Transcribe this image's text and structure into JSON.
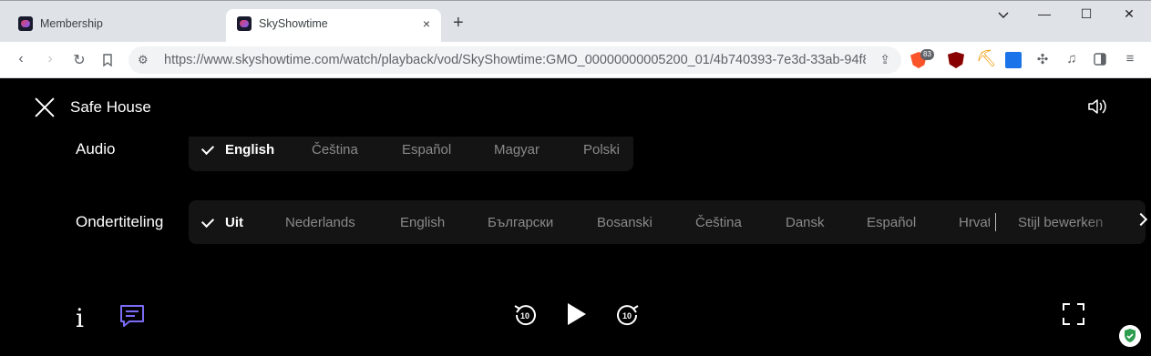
{
  "browser": {
    "tabs": [
      {
        "label": "Membership",
        "active": false
      },
      {
        "label": "SkyShowtime",
        "active": true
      }
    ],
    "tab_close": "×",
    "new_tab": "+",
    "window_controls": {
      "minimize_icon": "chevron-down-icon",
      "min": "—",
      "max": "☐",
      "close": "✕"
    },
    "url": "https://www.skyshowtime.com/watch/playback/vod/SkyShowtime:GMO_00000000005200_01/4b740393-7e3d-33ab-94f8-a...",
    "extension_badge": "83"
  },
  "player": {
    "title": "Safe House",
    "audio": {
      "label": "Audio",
      "options": [
        "English",
        "Čeština",
        "Español",
        "Magyar",
        "Polski"
      ],
      "selected": "English"
    },
    "subtitles": {
      "label": "Ondertiteling",
      "options": [
        "Uit",
        "Nederlands",
        "English",
        "Български",
        "Bosanski",
        "Čeština",
        "Dansk",
        "Español",
        "Hrvat"
      ],
      "selected": "Uit",
      "edit_style": "Stijl bewerken"
    },
    "info_label": "i",
    "rewind_seconds": "10",
    "forward_seconds": "10",
    "colors": {
      "accent": "#7b6cf6",
      "panel": "#141414",
      "shield": "#2e9d4f"
    }
  }
}
